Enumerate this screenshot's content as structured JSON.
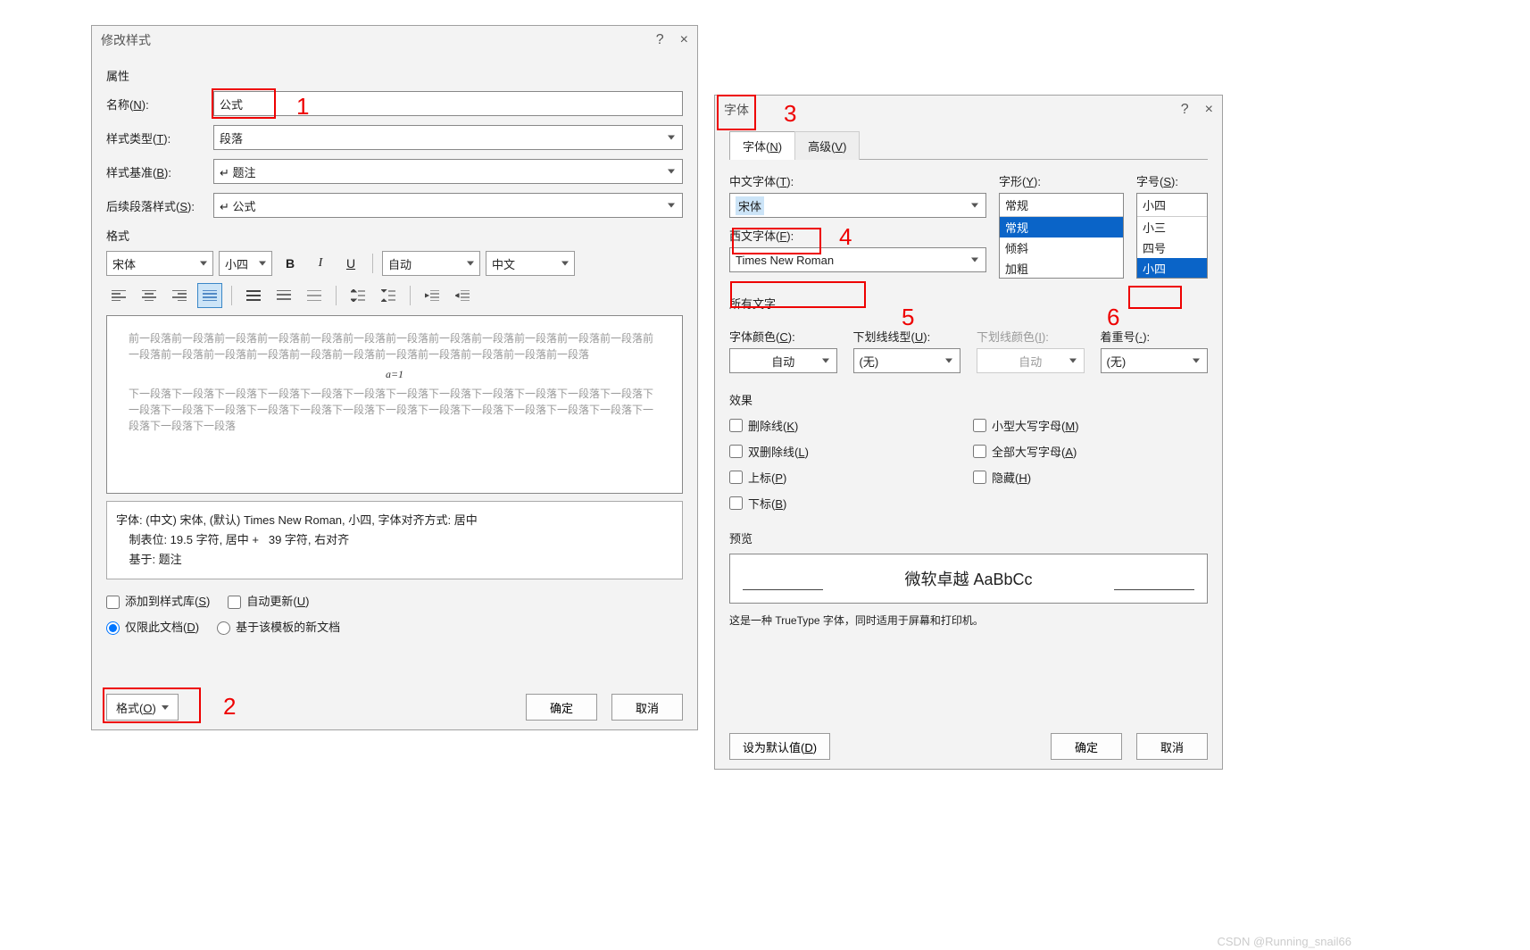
{
  "watermark": "CSDN @Running_snail66",
  "annotations": {
    "1": "1",
    "2": "2",
    "3": "3",
    "4": "4",
    "5": "5",
    "6": "6"
  },
  "d1": {
    "title": "修改样式",
    "help": "?",
    "close": "×",
    "section_props": "属性",
    "name_label": "名称(N):",
    "name_value": "公式",
    "type_label": "样式类型(T):",
    "type_value": "段落",
    "base_label": "样式基准(B):",
    "base_value": "↵ 题注",
    "next_label": "后续段落样式(S):",
    "next_value": "↵ 公式",
    "section_format": "格式",
    "font_combo": "宋体",
    "size_combo": "小四",
    "color_combo": "自动",
    "lang_combo": "中文",
    "preview_before_text": "前一段落前一段落前一段落前一段落前一段落前一段落前一段落前一段落前一段落前一段落前一段落前一段落前一段落前一段落前一段落前一段落前一段落前一段落前一段落前一段落前一段落前一段落前一段落",
    "preview_formula": "a=1",
    "preview_after_text": "下一段落下一段落下一段落下一段落下一段落下一段落下一段落下一段落下一段落下一段落下一段落下一段落下一段落下一段落下一段落下一段落下一段落下一段落下一段落下一段落下一段落下一段落下一段落下一段落下一段落下一段落下一段落",
    "desc_line1": "字体: (中文) 宋体, (默认) Times New Roman, 小四, 字体对齐方式: 居中",
    "desc_line2": "    制表位: 19.5 字符, 居中 +   39 字符, 右对齐",
    "desc_line3": "    基于: 题注",
    "chk_addlib": "添加到样式库(S)",
    "chk_autoupd": "自动更新(U)",
    "rb_doconly": "仅限此文档(D)",
    "rb_templ": "基于该模板的新文档",
    "format_btn": "格式(O)",
    "ok": "确定",
    "cancel": "取消"
  },
  "d2": {
    "title": "字体",
    "help": "?",
    "close": "×",
    "tab_font": "字体(N)",
    "tab_adv": "高级(V)",
    "cn_font_label": "中文字体(T):",
    "cn_font_value": "宋体",
    "en_font_label": "西文字体(F):",
    "en_font_value": "Times New Roman",
    "style_label": "字形(Y):",
    "style_value": "常规",
    "style_opts": [
      "常规",
      "倾斜",
      "加粗"
    ],
    "size_label": "字号(S):",
    "size_value": "小四",
    "size_opts": [
      "小三",
      "四号",
      "小四"
    ],
    "section_alltext": "所有文字",
    "fontcolor_label": "字体颜色(C):",
    "fontcolor_value": "自动",
    "ul_style_label": "下划线线型(U):",
    "ul_style_value": "(无)",
    "ul_color_label": "下划线颜色(I):",
    "ul_color_value": "自动",
    "emph_label": "着重号(·):",
    "emph_value": "(无)",
    "section_effects": "效果",
    "fx_strike": "删除线(K)",
    "fx_dstrike": "双删除线(L)",
    "fx_sup": "上标(P)",
    "fx_sub": "下标(B)",
    "fx_smallcaps": "小型大写字母(M)",
    "fx_allcaps": "全部大写字母(A)",
    "fx_hidden": "隐藏(H)",
    "section_preview": "预览",
    "preview_text": "微软卓越  AaBbCc",
    "note": "这是一种 TrueType 字体，同时适用于屏幕和打印机。",
    "setdefault": "设为默认值(D)",
    "ok": "确定",
    "cancel": "取消"
  }
}
